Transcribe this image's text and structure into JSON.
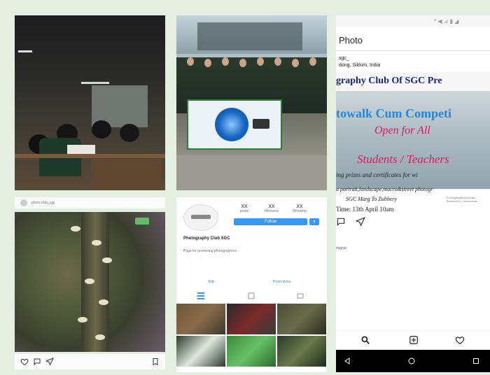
{
  "panel1": {
    "username": "photo.club_sgc"
  },
  "panel3": {
    "profile": {
      "stats": [
        {
          "value": "XX",
          "label": "posts"
        },
        {
          "value": "XX",
          "label": "followers"
        },
        {
          "value": "XX",
          "label": "following"
        }
      ],
      "follow_label": "Follow",
      "name": "Photography Club SGC",
      "bio": "Page for promoting photographers",
      "tabs": [
        "Edit",
        "Promotions"
      ]
    }
  },
  "panel4": {
    "status_bar": "* ◀ ⊿ ▮ ◢",
    "header_title": "Photo",
    "location_name": "sgc_",
    "location_sub": "dong, Sikkim, India",
    "poster": {
      "headline": "graphy Club Of SGC Pre",
      "band": "towalk Cum Competi",
      "open_for_all": "Open for All",
      "students": "Students / Teachers",
      "prizes": "ing prizes and certificates for wi",
      "categories": "a portrait,landscape,macro&street photogr",
      "venue": "SGC Marg To Zubbery",
      "time": "Time: 13th April 10am",
      "contact": "For registration contact: 9xxxxxxxxx / 9xxxxxxxxx"
    },
    "caption": "#sgcpc"
  },
  "colors": {
    "accent": "#3897f0",
    "page_bg": "#e4eee1",
    "poster_title": "#1a237e",
    "poster_band": "#1e88e5",
    "poster_script": "#d81b60"
  }
}
